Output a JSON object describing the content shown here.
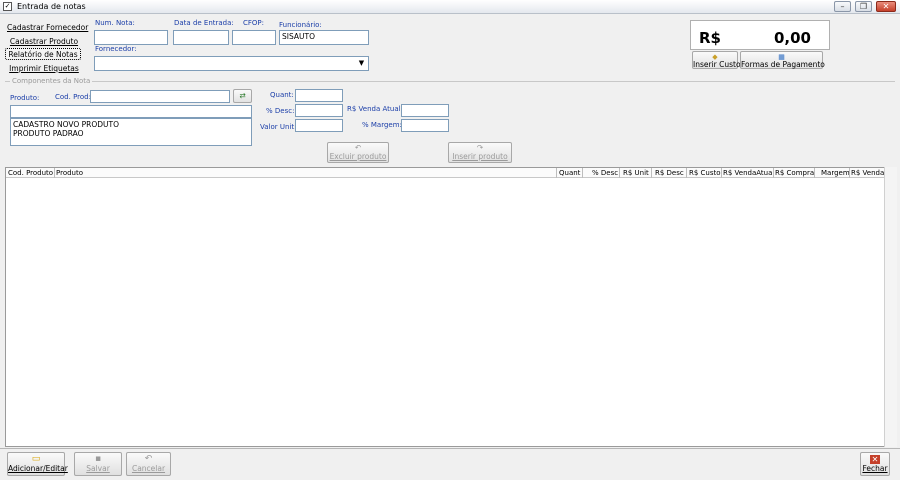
{
  "window": {
    "title": "Entrada de notas",
    "icon": "checkbox-icon"
  },
  "left_menu": {
    "items": [
      "Cadastrar Fornecedor",
      "Cadastrar Produto",
      "Relatório de Notas",
      "Imprimir Etiquetas"
    ]
  },
  "header_fields": {
    "num_nota": {
      "label": "Num. Nota:",
      "value": ""
    },
    "data_entrada": {
      "label": "Data de Entrada:",
      "value": ""
    },
    "cfop": {
      "label": "CFOP:",
      "value": ""
    },
    "funcionario": {
      "label": "Funcionário:",
      "value": "SISAUTO"
    },
    "fornecedor": {
      "label": "Fornecedor:",
      "value": ""
    }
  },
  "total": {
    "currency": "R$",
    "value": "0,00"
  },
  "total_buttons": {
    "custos": "Inserir Custos",
    "pagamento": "Formas de Pagamento"
  },
  "componentes": {
    "group_title": "Componentes da Nota",
    "produto_label": "Produto:",
    "cod_prod_label": "Cod. Prod:",
    "cod_prod_value": "",
    "product_list": [
      "CADASTRO NOVO PRODUTO",
      "PRODUTO PADRAO"
    ],
    "quant_label": "Quant:",
    "desc_label": "% Desc:",
    "valor_unit_label": "Valor Unit:",
    "venda_atual_label": "R$ Venda Atual:",
    "margem_label": "% Margem:",
    "excluir_button": "Excluir produto",
    "inserir_button": "Inserir produto"
  },
  "grid": {
    "columns": [
      "Cod. Produto",
      "Produto",
      "Quant",
      "% Desc",
      "R$ Unit",
      "R$ Desc",
      "R$ Custo",
      "R$ VendaAtual",
      "R$ Compra",
      "Margem",
      "R$ Venda"
    ],
    "rows": []
  },
  "bottom_buttons": {
    "adicionar": "Adicionar/Editar",
    "salvar": "Salvar",
    "cancelar": "Cancelar",
    "fechar": "Fechar"
  },
  "colors": {
    "label_blue": "#1b3ea8",
    "field_border": "#7f9db9",
    "close_red": "#c5402a"
  }
}
